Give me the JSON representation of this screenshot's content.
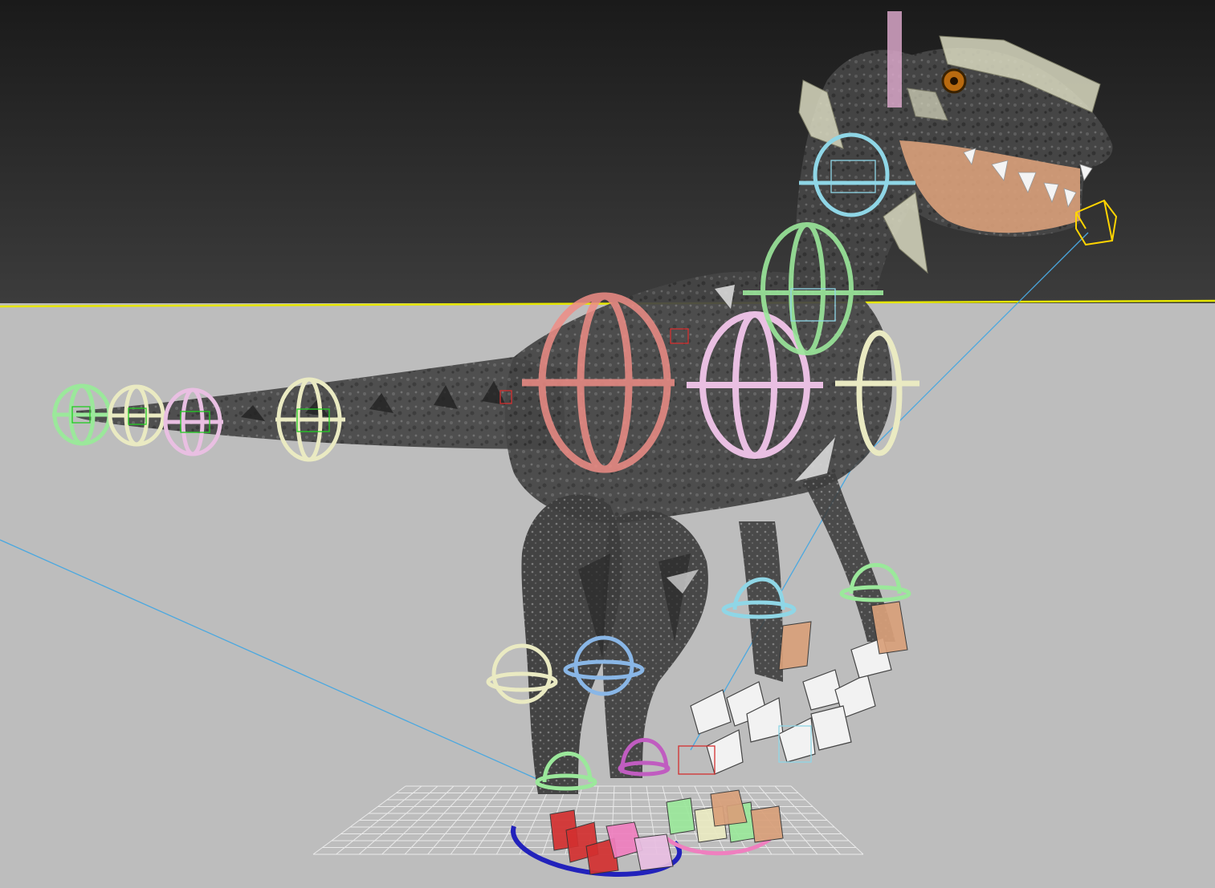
{
  "viewport": {
    "sky_color": "#1a1a1a",
    "sky_color_light": "#3c3c3c",
    "floor_color": "#bdbdbd",
    "horizon_color": "#e6e600",
    "grid_color": "#f2f2f2",
    "guide_line_color": "#4aa8e0"
  },
  "model": {
    "skin_color": "#454545",
    "skin_dark": "#2b2b2b",
    "skin_light": "#6d6d6d",
    "mouth_color": "#d9a07a",
    "eye_color": "#b86a10"
  },
  "rig_colors": {
    "green": "#9be89b",
    "cream": "#eaeac2",
    "pink": "#e9bfe2",
    "salmon": "#ef8d86",
    "light_blue": "#8fd6e6",
    "blue": "#89b6e6",
    "magenta": "#c05cc0",
    "yellow": "#ffd400",
    "foot_blue": "#2222bb",
    "foot_red": "#d33030",
    "foot_pink": "#ef7fbf",
    "bone_green": "#22cc22",
    "neck_bone": "#d8a6c8",
    "claw_white": "#f2f2f2"
  },
  "controls": {
    "tail_rings": [
      {
        "name": "tail-ring-1",
        "color": "green",
        "u": 0
      },
      {
        "name": "tail-ring-2",
        "color": "cream",
        "u": 1
      },
      {
        "name": "tail-ring-3",
        "color": "pink",
        "u": 2
      },
      {
        "name": "tail-ring-4",
        "color": "cream",
        "u": 3
      }
    ],
    "spine_rings": [
      {
        "name": "pelvis-ring",
        "color": "salmon"
      },
      {
        "name": "chest-ring",
        "color": "pink"
      },
      {
        "name": "shoulder-ring",
        "color": "cream"
      },
      {
        "name": "neck-ring-lower",
        "color": "green"
      },
      {
        "name": "neck-ring-upper",
        "color": "light_blue"
      }
    ],
    "leg_rings": [
      {
        "name": "back-knee-left-ring",
        "color": "cream"
      },
      {
        "name": "back-knee-right-ring",
        "color": "blue"
      },
      {
        "name": "arm-ring-left",
        "color": "light_blue"
      },
      {
        "name": "arm-ring-right",
        "color": "green"
      },
      {
        "name": "ankle-ring-left",
        "color": "green"
      },
      {
        "name": "ankle-ring-right",
        "color": "magenta"
      }
    ],
    "jaw_target": {
      "name": "jaw-target-box",
      "color": "yellow"
    },
    "foot_controls": [
      {
        "name": "foot-control-left",
        "color": "foot_blue"
      },
      {
        "name": "foot-control-right",
        "color": "foot_pink"
      }
    ]
  }
}
